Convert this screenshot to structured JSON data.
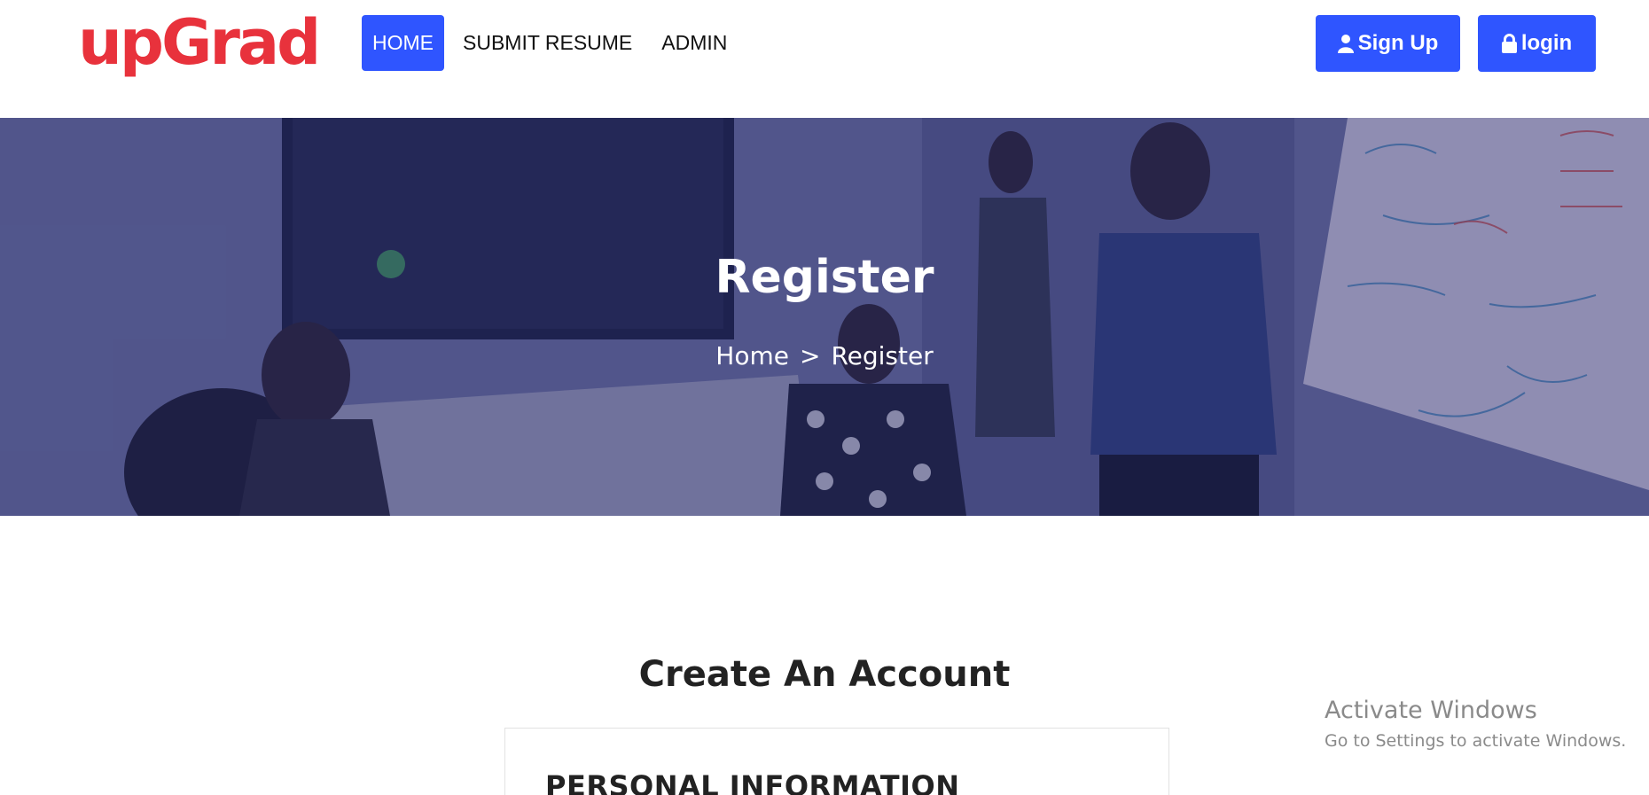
{
  "header": {
    "logo_text": "upGrad",
    "nav": [
      {
        "label": "HOME",
        "active": true
      },
      {
        "label": "SUBMIT RESUME",
        "active": false
      },
      {
        "label": "ADMIN",
        "active": false
      }
    ],
    "signup_label": "Sign Up",
    "login_label": "login",
    "signup_icon": "user-icon",
    "login_icon": "lock-icon"
  },
  "hero": {
    "title": "Register",
    "breadcrumb": {
      "home": "Home",
      "separator": ">",
      "current": "Register"
    }
  },
  "main": {
    "section_title": "Create An Account",
    "card_title": "PERSONAL INFORMATION"
  },
  "watermark": {
    "title": "Activate Windows",
    "subtitle": "Go to Settings to activate Windows."
  },
  "colors": {
    "brand_red": "#e8323c",
    "accent_blue": "#2f55ff",
    "hero_overlay": "#21266e"
  }
}
